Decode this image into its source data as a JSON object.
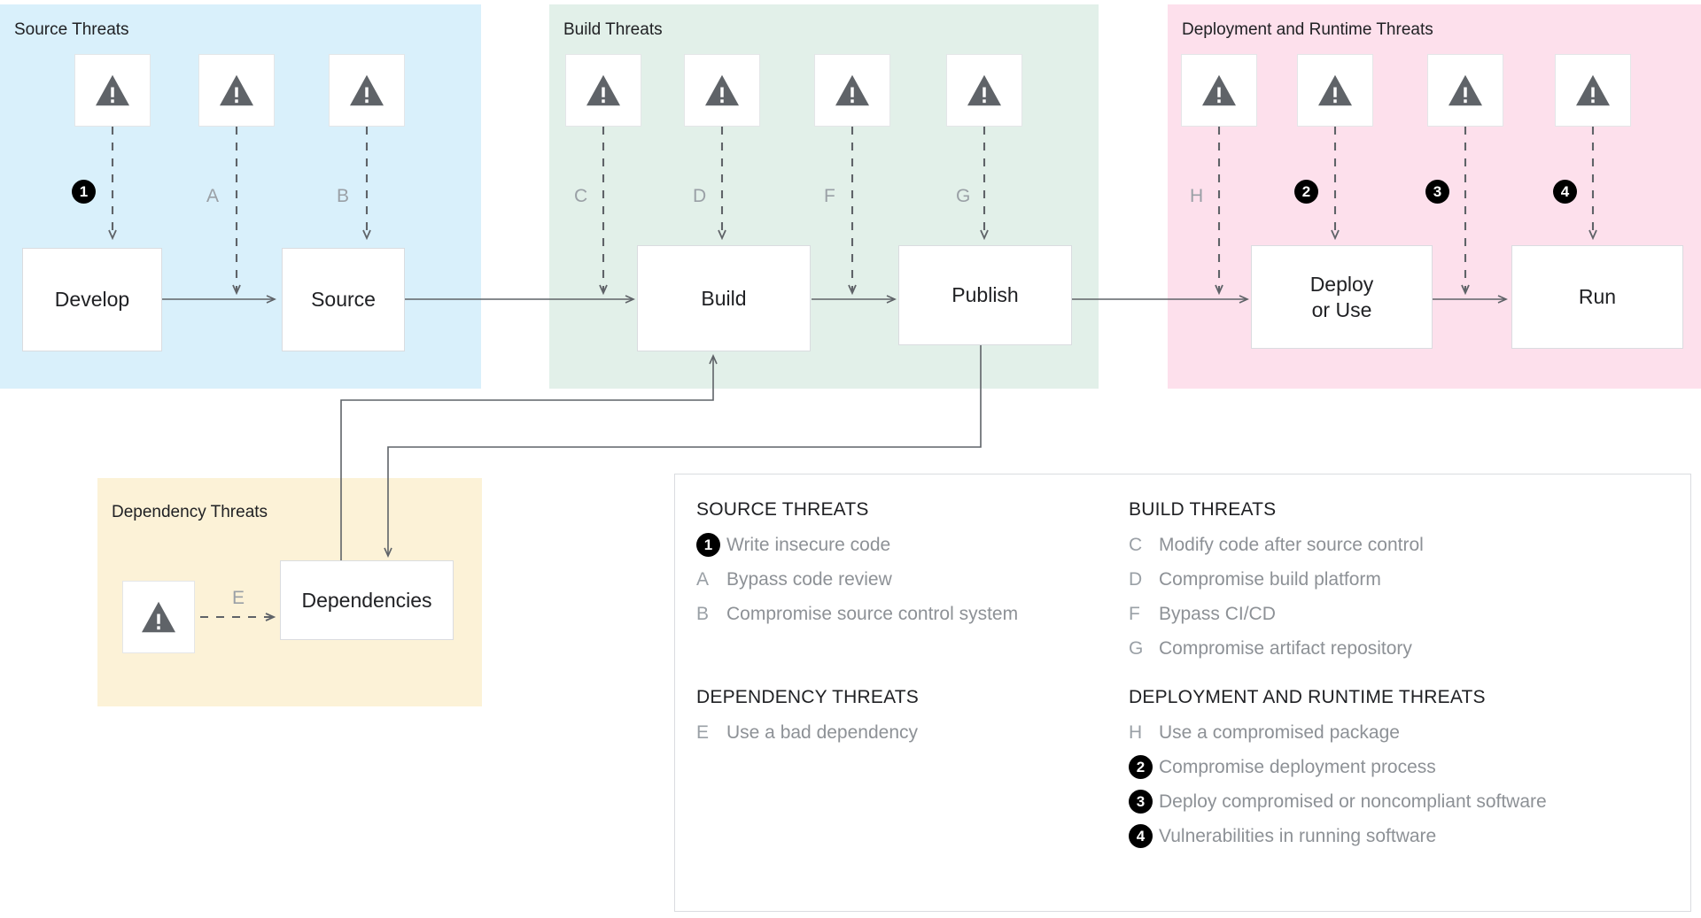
{
  "panels": {
    "source": {
      "title": "Source Threats"
    },
    "build": {
      "title": "Build Threats"
    },
    "deploy": {
      "title": "Deployment and Runtime Threats"
    },
    "dependency": {
      "title": "Dependency Threats"
    }
  },
  "nodes": {
    "develop": {
      "label": "Develop"
    },
    "source": {
      "label": "Source"
    },
    "build": {
      "label": "Build"
    },
    "publish": {
      "label": "Publish"
    },
    "deploy_or_use": {
      "line1": "Deploy",
      "line2": "or Use"
    },
    "run": {
      "label": "Run"
    },
    "dependencies": {
      "label": "Dependencies"
    }
  },
  "markers": {
    "m1": "1",
    "mA": "A",
    "mB": "B",
    "mC": "C",
    "mD": "D",
    "mF": "F",
    "mG": "G",
    "mH": "H",
    "m2": "2",
    "m3": "3",
    "m4": "4",
    "mE": "E"
  },
  "icons": {
    "warning": "warning-triangle-icon"
  },
  "colors": {
    "source_panel": "#d9f0fb",
    "build_panel": "#e2f0e9",
    "deploy_panel": "#fde0ec",
    "dependency_panel": "#fcf2d7",
    "badge": "#000000",
    "node_border": "#dadce0",
    "arrow": "#5f6368",
    "warning_icon": "#5f6368",
    "legend_text": "#8d9196"
  },
  "legend": {
    "source": {
      "heading": "SOURCE THREATS",
      "items": [
        {
          "key": "1",
          "badge": true,
          "text": "Write insecure code"
        },
        {
          "key": "A",
          "badge": false,
          "text": "Bypass code review"
        },
        {
          "key": "B",
          "badge": false,
          "text": "Compromise source control system"
        }
      ]
    },
    "build": {
      "heading": "BUILD THREATS",
      "items": [
        {
          "key": "C",
          "badge": false,
          "text": "Modify code after source control"
        },
        {
          "key": "D",
          "badge": false,
          "text": "Compromise build platform"
        },
        {
          "key": "F",
          "badge": false,
          "text": "Bypass CI/CD"
        },
        {
          "key": "G",
          "badge": false,
          "text": "Compromise artifact repository"
        }
      ]
    },
    "dependency": {
      "heading": "DEPENDENCY THREATS",
      "items": [
        {
          "key": "E",
          "badge": false,
          "text": "Use a bad dependency"
        }
      ]
    },
    "deployment": {
      "heading": "DEPLOYMENT AND RUNTIME THREATS",
      "items": [
        {
          "key": "H",
          "badge": false,
          "text": "Use a compromised package"
        },
        {
          "key": "2",
          "badge": true,
          "text": "Compromise deployment process"
        },
        {
          "key": "3",
          "badge": true,
          "text": "Deploy compromised or noncompliant software"
        },
        {
          "key": "4",
          "badge": true,
          "text": "Vulnerabilities in running software"
        }
      ]
    }
  }
}
